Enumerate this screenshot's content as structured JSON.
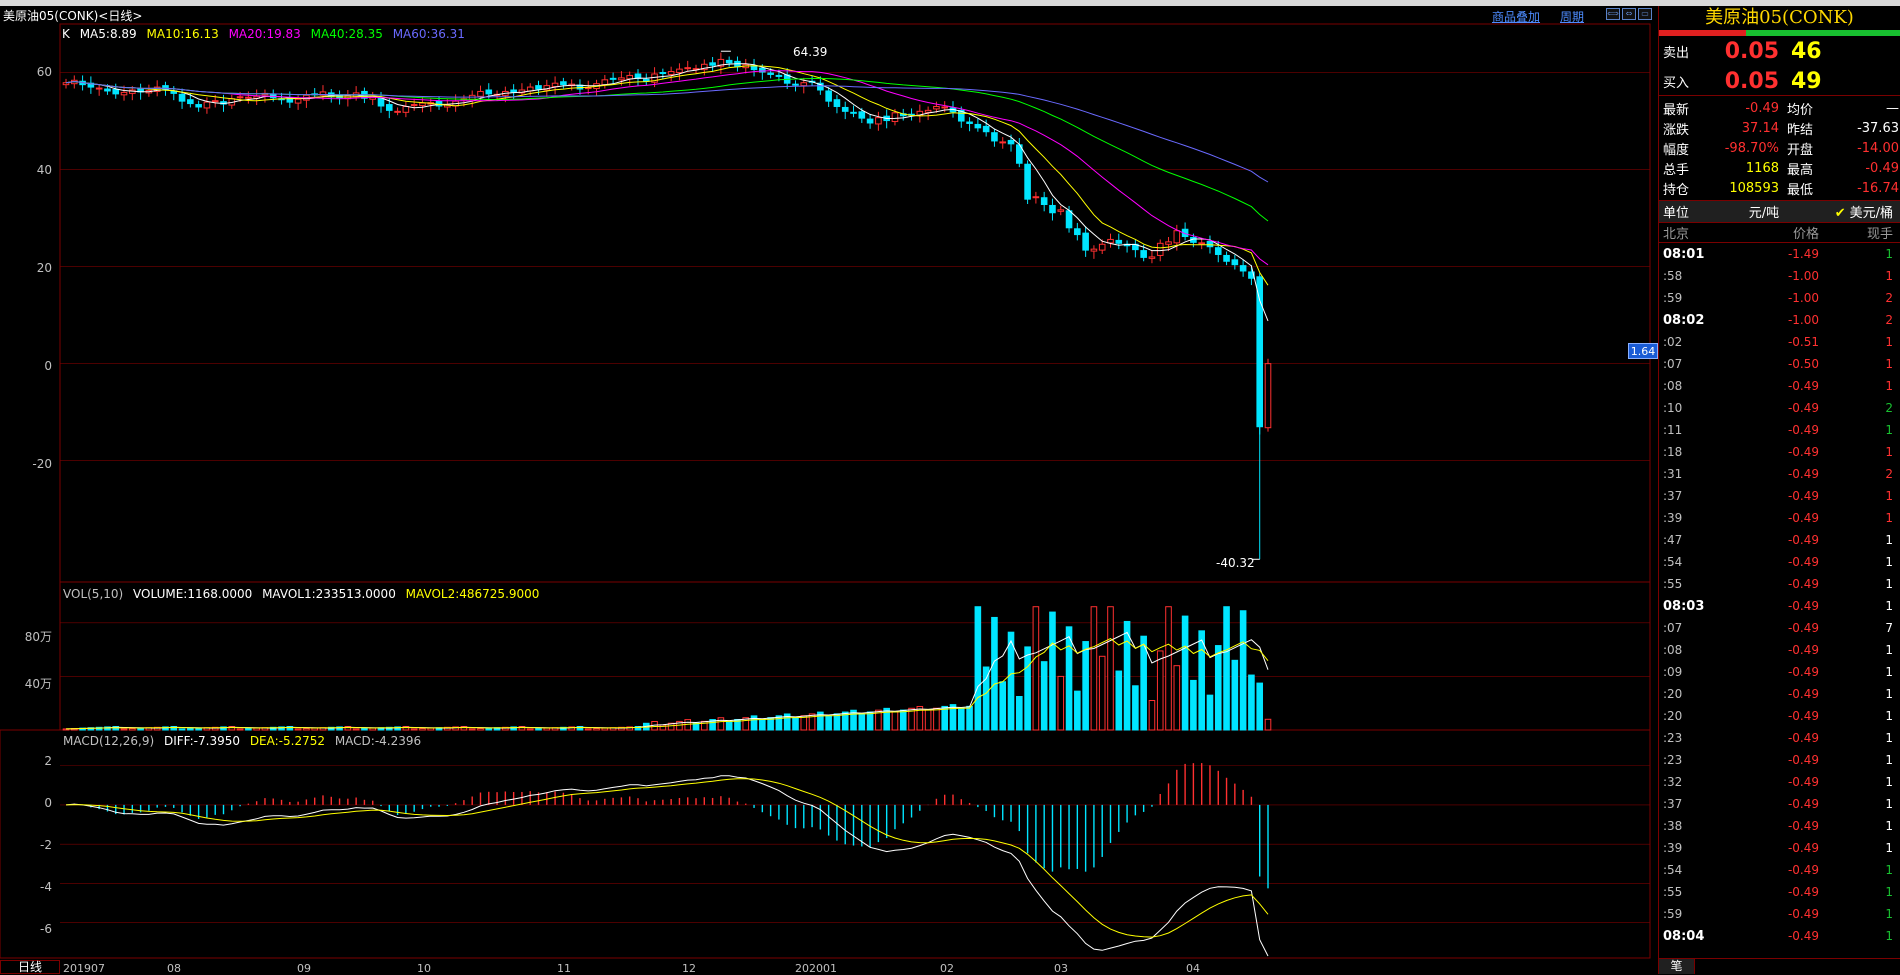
{
  "header": {
    "title": "美原油05(CONK)<日线>",
    "link_overlay": "商品叠加",
    "link_period": "周期"
  },
  "ma_legend": {
    "k": "K",
    "ma5": "MA5:8.89",
    "ma10": "MA10:16.13",
    "ma20": "MA20:19.83",
    "ma40": "MA40:28.35",
    "ma60": "MA60:36.31"
  },
  "vol_legend": {
    "name": "VOL(5,10)",
    "volume": "VOLUME:1168.0000",
    "mavol1": "MAVOL1:233513.0000",
    "mavol2": "MAVOL2:486725.9000"
  },
  "macd_legend": {
    "name": "MACD(12,26,9)",
    "diff": "DIFF:-7.3950",
    "dea": "DEA:-5.2752",
    "macd": "MACD:-4.2396"
  },
  "price_tag": "1.64",
  "period_tab": "日线",
  "colors": {
    "ma5": "#ffffff",
    "ma10": "#ffff00",
    "ma20": "#ff00ff",
    "ma40": "#00ff00",
    "ma60": "#6a6aff",
    "up": "#ff3030",
    "down": "#00e5ff",
    "grid": "#7a0000"
  },
  "chart_data": [
    {
      "type": "candlestick",
      "title": "美原油05(CONK)<日线>",
      "ylim": [
        -45,
        70
      ],
      "yticks": [
        "60",
        "40",
        "20",
        "0",
        "-20"
      ],
      "xticks": [
        "201907",
        "08",
        "09",
        "10",
        "11",
        "12",
        "202001",
        "02",
        "03",
        "04"
      ],
      "annotations": {
        "high": "64.39",
        "low": "-40.32"
      },
      "series": [
        {
          "name": "MA5",
          "last": 8.89
        },
        {
          "name": "MA10",
          "last": 16.13
        },
        {
          "name": "MA20",
          "last": 19.83
        },
        {
          "name": "MA40",
          "last": 28.35
        },
        {
          "name": "MA60",
          "last": 36.31
        }
      ],
      "close": [
        57.9,
        58.4,
        57.5,
        57.0,
        56.8,
        56.2,
        55.6,
        55.9,
        56.4,
        56.0,
        56.3,
        57.0,
        56.4,
        55.7,
        54.1,
        53.6,
        52.9,
        53.9,
        54.2,
        53.5,
        54.6,
        55.0,
        54.9,
        55.1,
        55.7,
        54.8,
        54.4,
        53.9,
        54.5,
        55.3,
        55.5,
        56.0,
        55.0,
        54.8,
        55.2,
        55.8,
        54.7,
        55.0,
        53.1,
        52.2,
        52.0,
        53.0,
        53.4,
        53.7,
        53.8,
        53.1,
        53.3,
        54.1,
        54.6,
        55.3,
        56.1,
        55.6,
        55.5,
        56.1,
        56.0,
        56.4,
        57.0,
        56.6,
        57.3,
        57.8,
        57.5,
        57.6,
        56.6,
        56.9,
        57.7,
        58.5,
        58.7,
        58.9,
        59.4,
        58.8,
        58.2,
        59.7,
        59.8,
        60.2,
        60.7,
        61.0,
        60.8,
        61.7,
        61.5,
        62.7,
        62.0,
        61.2,
        61.6,
        60.6,
        60.1,
        59.6,
        59.2,
        57.8,
        57.5,
        57.9,
        58.0,
        56.4,
        54.1,
        53.0,
        52.0,
        51.6,
        50.6,
        49.6,
        50.7,
        50.1,
        51.7,
        51.1,
        51.3,
        52.0,
        52.2,
        53.0,
        52.9,
        51.9,
        50.0,
        49.5,
        48.6,
        47.8,
        45.9,
        45.7,
        45.3,
        41.3,
        33.9,
        34.4,
        32.8,
        31.1,
        31.7,
        28.0,
        26.6,
        23.4,
        23.6,
        24.6,
        25.6,
        24.8,
        24.3,
        23.5,
        21.9,
        22.0,
        24.8,
        25.1,
        27.4,
        26.2,
        25.0,
        24.9,
        24.1,
        22.5,
        21.1,
        20.4,
        19.1,
        17.6,
        -13.0,
        0.0
      ],
      "volume_unit": "万",
      "volume_yticks": [
        "80万",
        "40万"
      ],
      "macd": {
        "diff": -7.395,
        "dea": -5.2752,
        "macd": -4.2396,
        "yticks": [
          "2",
          "0",
          "-2",
          "-4",
          "-6"
        ]
      }
    }
  ],
  "panel": {
    "title": "美原油05(CONK)",
    "sell": {
      "label": "卖出",
      "price": "0.05",
      "vol": "46"
    },
    "buy": {
      "label": "买入",
      "price": "0.05",
      "vol": "49"
    },
    "quote": [
      {
        "k1": "最新",
        "v1": "-0.49",
        "c1": "red",
        "k2": "均价",
        "v2": "—",
        "c2": "wht"
      },
      {
        "k1": "涨跌",
        "v1": "37.14",
        "c1": "red",
        "k2": "昨结",
        "v2": "-37.63",
        "c2": "wht"
      },
      {
        "k1": "幅度",
        "v1": "-98.70%",
        "c1": "red",
        "k2": "开盘",
        "v2": "-14.00",
        "c2": "red"
      },
      {
        "k1": "总手",
        "v1": "1168",
        "c1": "yel",
        "k2": "最高",
        "v2": "-0.49",
        "c2": "red"
      },
      {
        "k1": "持仓",
        "v1": "108593",
        "c1": "yel",
        "k2": "最低",
        "v2": "-16.74",
        "c2": "red"
      }
    ],
    "unit": {
      "label": "单位",
      "opt1": "元/吨",
      "opt2": "美元/桶",
      "check": "✔"
    },
    "thead": {
      "time": "北京",
      "price": "价格",
      "vol": "现手"
    },
    "ticks": [
      {
        "t": "08:01",
        "major": true,
        "p": "-1.49",
        "v": "1",
        "vc": "grn"
      },
      {
        "t": ":58",
        "p": "-1.00",
        "v": "1",
        "vc": "red"
      },
      {
        "t": ":59",
        "p": "-1.00",
        "v": "2",
        "vc": "red"
      },
      {
        "t": "08:02",
        "major": true,
        "p": "-1.00",
        "v": "2",
        "vc": "red"
      },
      {
        "t": ":02",
        "p": "-0.51",
        "v": "1",
        "vc": "red"
      },
      {
        "t": ":07",
        "p": "-0.50",
        "v": "1",
        "vc": "red"
      },
      {
        "t": ":08",
        "p": "-0.49",
        "v": "1",
        "vc": "red"
      },
      {
        "t": ":10",
        "p": "-0.49",
        "v": "2",
        "vc": "grn"
      },
      {
        "t": ":11",
        "p": "-0.49",
        "v": "1",
        "vc": "grn"
      },
      {
        "t": ":18",
        "p": "-0.49",
        "v": "1",
        "vc": "red"
      },
      {
        "t": ":31",
        "p": "-0.49",
        "v": "2",
        "vc": "red"
      },
      {
        "t": ":37",
        "p": "-0.49",
        "v": "1",
        "vc": "red"
      },
      {
        "t": ":39",
        "p": "-0.49",
        "v": "1",
        "vc": "red"
      },
      {
        "t": ":47",
        "p": "-0.49",
        "v": "1",
        "vc": "wht"
      },
      {
        "t": ":54",
        "p": "-0.49",
        "v": "1",
        "vc": "wht"
      },
      {
        "t": ":55",
        "p": "-0.49",
        "v": "1",
        "vc": "wht"
      },
      {
        "t": "08:03",
        "major": true,
        "p": "-0.49",
        "v": "1",
        "vc": "wht"
      },
      {
        "t": ":07",
        "p": "-0.49",
        "v": "7",
        "vc": "wht"
      },
      {
        "t": ":08",
        "p": "-0.49",
        "v": "1",
        "vc": "wht"
      },
      {
        "t": ":09",
        "p": "-0.49",
        "v": "1",
        "vc": "wht"
      },
      {
        "t": ":20",
        "p": "-0.49",
        "v": "1",
        "vc": "wht"
      },
      {
        "t": ":20",
        "p": "-0.49",
        "v": "1",
        "vc": "wht"
      },
      {
        "t": ":23",
        "p": "-0.49",
        "v": "1",
        "vc": "wht"
      },
      {
        "t": ":23",
        "p": "-0.49",
        "v": "1",
        "vc": "wht"
      },
      {
        "t": ":32",
        "p": "-0.49",
        "v": "1",
        "vc": "wht"
      },
      {
        "t": ":37",
        "p": "-0.49",
        "v": "1",
        "vc": "wht"
      },
      {
        "t": ":38",
        "p": "-0.49",
        "v": "1",
        "vc": "wht"
      },
      {
        "t": ":39",
        "p": "-0.49",
        "v": "1",
        "vc": "wht"
      },
      {
        "t": ":54",
        "p": "-0.49",
        "v": "1",
        "vc": "grn"
      },
      {
        "t": ":55",
        "p": "-0.49",
        "v": "1",
        "vc": "grn"
      },
      {
        "t": ":59",
        "p": "-0.49",
        "v": "1",
        "vc": "grn"
      },
      {
        "t": "08:04",
        "major": true,
        "p": "-0.49",
        "v": "1",
        "vc": "grn"
      }
    ],
    "foot_tab": "笔"
  }
}
